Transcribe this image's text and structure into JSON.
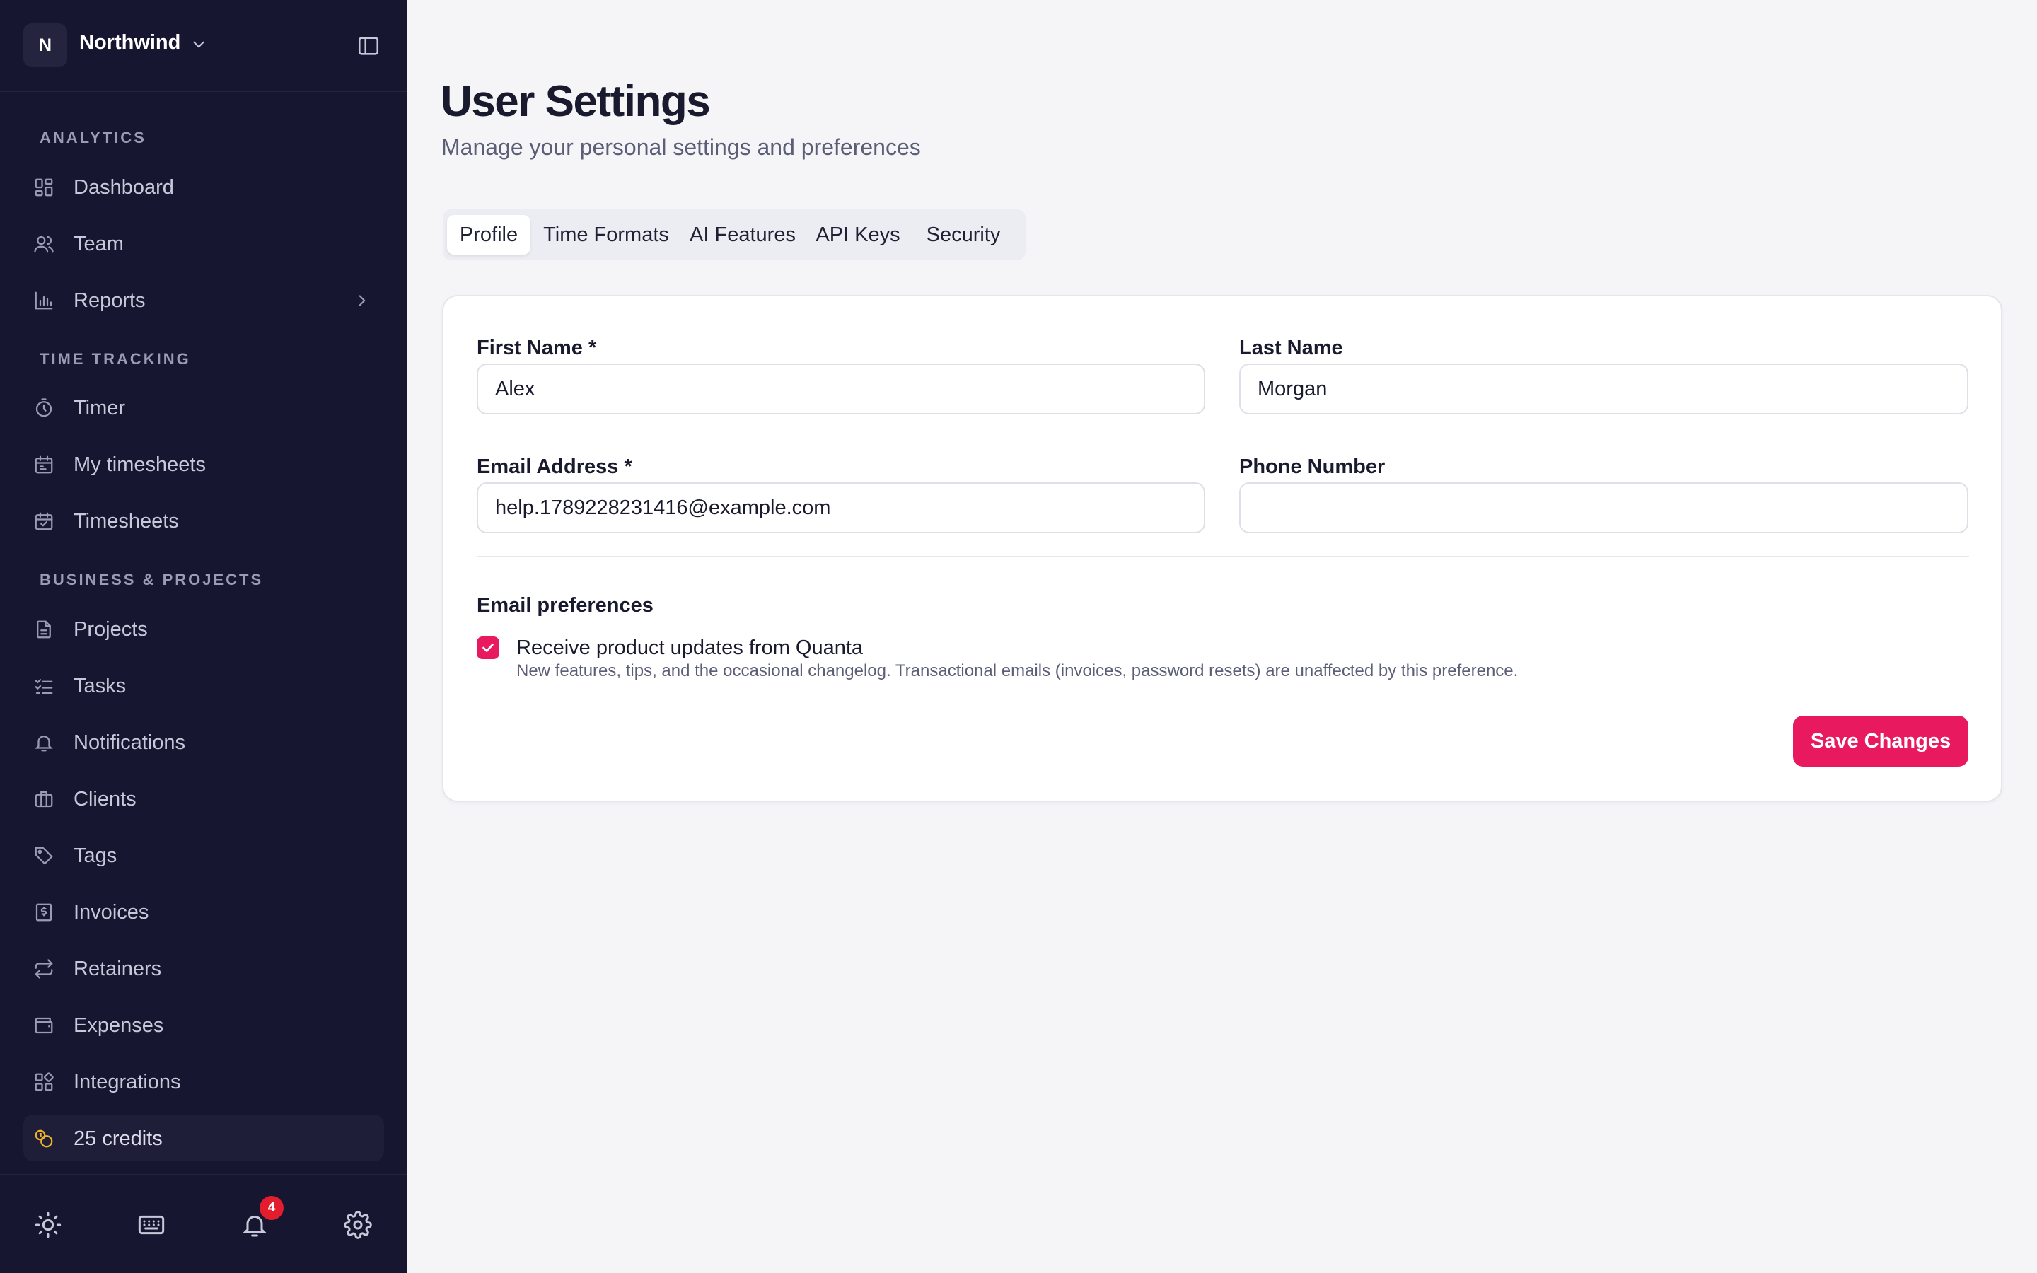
{
  "workspace": {
    "initial": "N",
    "name": "Northwind"
  },
  "sidebar": {
    "sections": [
      {
        "label": "ANALYTICS"
      },
      {
        "label": "TIME TRACKING"
      },
      {
        "label": "BUSINESS & PROJECTS"
      }
    ],
    "items": [
      {
        "label": "Dashboard",
        "icon": "dashboard-icon"
      },
      {
        "label": "Team",
        "icon": "team-icon"
      },
      {
        "label": "Reports",
        "icon": "reports-icon"
      },
      {
        "label": "Timer",
        "icon": "timer-icon"
      },
      {
        "label": "My timesheets",
        "icon": "calendar-icon"
      },
      {
        "label": "Timesheets",
        "icon": "calendar-check-icon"
      },
      {
        "label": "Projects",
        "icon": "document-icon"
      },
      {
        "label": "Tasks",
        "icon": "checklist-icon"
      },
      {
        "label": "Notifications",
        "icon": "bell-icon"
      },
      {
        "label": "Clients",
        "icon": "briefcase-icon"
      },
      {
        "label": "Tags",
        "icon": "tag-icon"
      },
      {
        "label": "Invoices",
        "icon": "invoice-icon"
      },
      {
        "label": "Retainers",
        "icon": "repeat-icon"
      },
      {
        "label": "Expenses",
        "icon": "wallet-icon"
      },
      {
        "label": "Integrations",
        "icon": "integrations-icon"
      }
    ],
    "credits": {
      "label": "25 credits",
      "icon": "coins-icon"
    },
    "footer": {
      "notification_count": "4"
    }
  },
  "header": {
    "title": "User Settings",
    "subtitle": "Manage your personal settings and preferences"
  },
  "tabs": [
    {
      "label": "Profile",
      "active": true
    },
    {
      "label": "Time Formats",
      "active": false
    },
    {
      "label": "AI Features",
      "active": false
    },
    {
      "label": "API Keys",
      "active": false
    },
    {
      "label": "Security",
      "active": false
    }
  ],
  "form": {
    "first_name": {
      "label": "First Name *",
      "value": "Alex"
    },
    "last_name": {
      "label": "Last Name",
      "value": "Morgan"
    },
    "email": {
      "label": "Email Address *",
      "value": "help.1789228231416@example.com"
    },
    "phone": {
      "label": "Phone Number",
      "value": ""
    },
    "preferences": {
      "title": "Email preferences",
      "product_updates": {
        "label": "Receive product updates from Quanta",
        "description": "New features, tips, and the occasional changelog. Transactional emails (invoices, password resets) are unaffected by this preference.",
        "checked": true
      }
    },
    "save_label": "Save Changes"
  },
  "colors": {
    "sidebar_bg": "#161630",
    "accent": "#e8195e",
    "badge": "#e11d2e",
    "credits_icon": "#f0b429"
  }
}
